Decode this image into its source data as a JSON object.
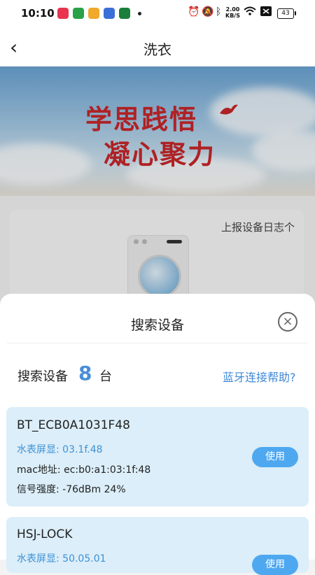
{
  "status_bar": {
    "time": "10:10",
    "apps": [
      {
        "icon": "video-app-icon",
        "color": "#e8344f"
      },
      {
        "icon": "wechat-icon",
        "color": "#2aa147"
      },
      {
        "icon": "weibo-icon",
        "color": "#f0a92a"
      },
      {
        "icon": "baidu-icon",
        "color": "#3b6fd8"
      },
      {
        "icon": "oppo-icon",
        "color": "#1a7f3c"
      }
    ],
    "net_speed_value": "2.00",
    "net_speed_unit": "KB/S",
    "battery": "43"
  },
  "header": {
    "back_symbol": "‹",
    "title": "洗衣"
  },
  "banner": {
    "line1": "学思践悟",
    "line2": "凝心聚力"
  },
  "device_card": {
    "report_link": "上报设备日志个"
  },
  "sheet": {
    "title": "搜索设备",
    "close_symbol": "×",
    "search_label": "搜索设备",
    "count": "8",
    "unit": "台",
    "help_link": "蓝牙连接帮助?",
    "devices": [
      {
        "name": "BT_ECB0A1031F48",
        "screen_label": "水表屏显:",
        "screen_value": "03.1f.48",
        "mac_label": "mac地址:",
        "mac_value": "ec:b0:a1:03:1f:48",
        "signal_label": "信号强度:",
        "signal_value": "-76dBm 24%",
        "use_label": "使用"
      },
      {
        "name": "HSJ-LOCK",
        "screen_label": "水表屏显:",
        "screen_value": "50.05.01",
        "use_label": "使用"
      }
    ]
  },
  "colors": {
    "accent": "#4a8ed8",
    "item_bg": "#dbeef9",
    "button": "#4ea8f0",
    "banner_text": "#c8262a"
  }
}
